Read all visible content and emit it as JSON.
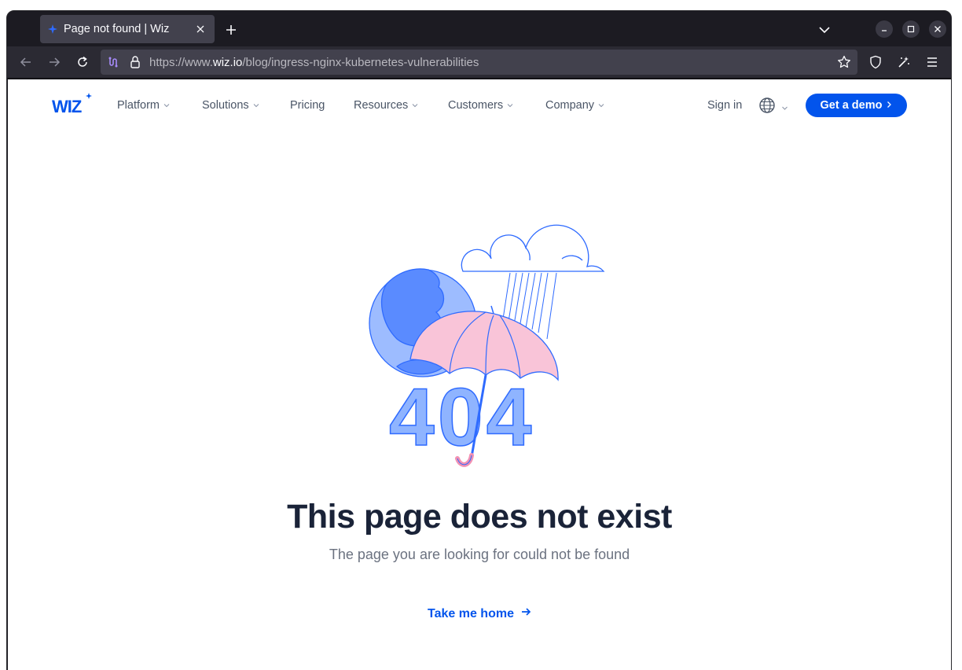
{
  "browser": {
    "tab_title": "Page not found | Wiz",
    "url_prefix": "https://www.",
    "url_host": "wiz.io",
    "url_path": "/blog/ingress-nginx-kubernetes-vulnerabilities"
  },
  "site_nav": {
    "logo_text": "WIZ",
    "items": [
      {
        "label": "Platform",
        "has_dropdown": true
      },
      {
        "label": "Solutions",
        "has_dropdown": true
      },
      {
        "label": "Pricing",
        "has_dropdown": false
      },
      {
        "label": "Resources",
        "has_dropdown": true
      },
      {
        "label": "Customers",
        "has_dropdown": true
      },
      {
        "label": "Company",
        "has_dropdown": true
      }
    ],
    "signin": "Sign in",
    "cta": "Get a demo"
  },
  "main": {
    "illustration_text": "404",
    "headline": "This page does not exist",
    "subline": "The page you are looking for could not be found",
    "home_link": "Take me home"
  },
  "colors": {
    "brand_blue": "#0254ec",
    "headline": "#1a2338",
    "umbrella_pink": "#f9c4d8",
    "digit_fill": "#8fb4ff"
  },
  "icons": [
    "back-icon",
    "forward-icon",
    "reload-icon",
    "lock-icon",
    "bookmark-star-icon",
    "shield-icon",
    "extensions-icon",
    "menu-icon",
    "globe-icon",
    "arrow-right-icon"
  ]
}
